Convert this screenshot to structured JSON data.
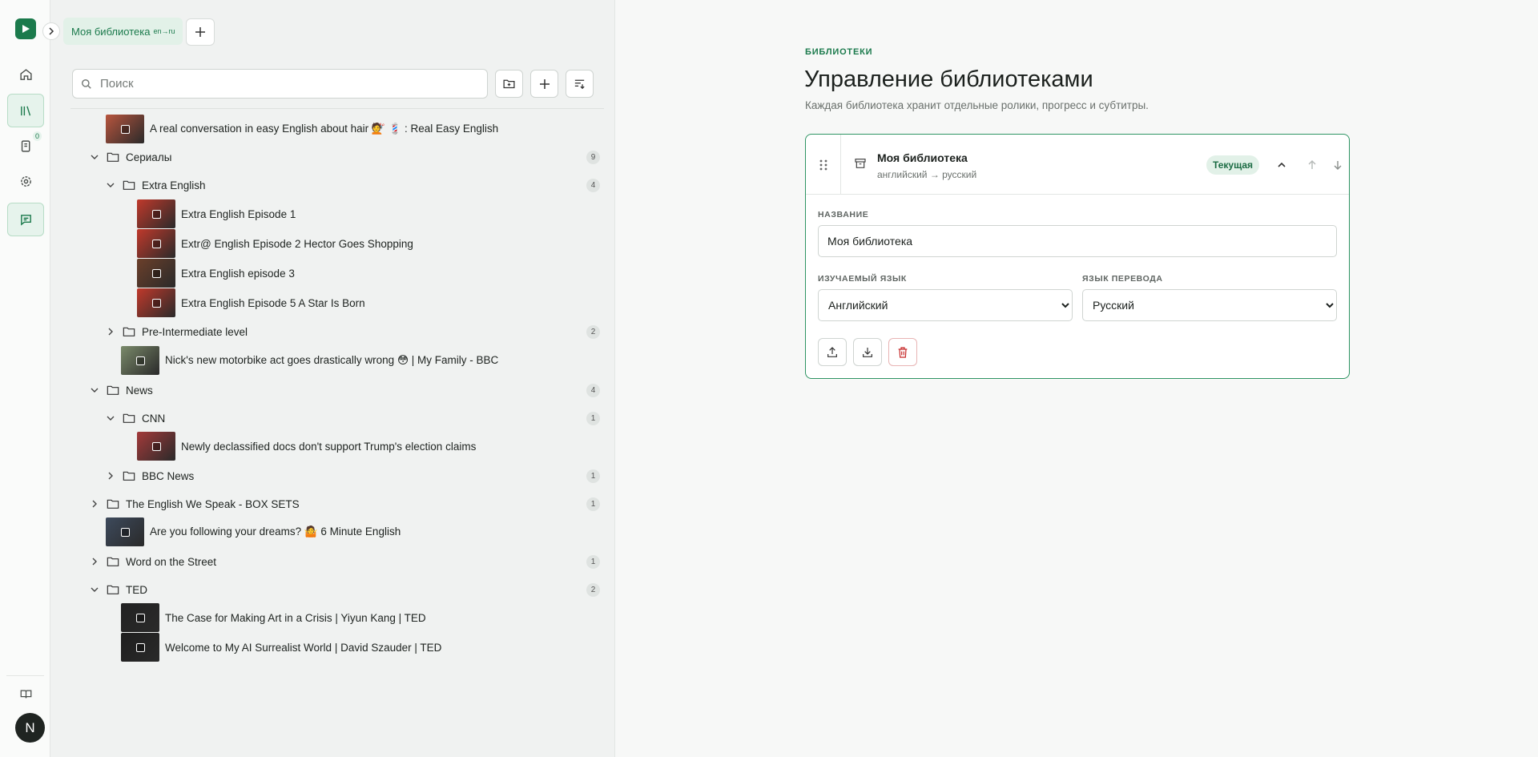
{
  "rail": {
    "notes_badge": "0",
    "avatar_letter": "N"
  },
  "sidebar": {
    "library_tab": {
      "name": "Моя библиотека",
      "langs": "en→ru"
    },
    "search": {
      "placeholder": "Поиск",
      "value": ""
    },
    "tree": [
      {
        "type": "video",
        "title": "A real conversation in easy English about hair 💇 💈 : Real Easy English",
        "thumb": "#b8553e"
      },
      {
        "type": "folder",
        "title": "Сериалы",
        "open": true,
        "count": "9"
      },
      {
        "type": "folder",
        "title": "Extra English",
        "open": true,
        "count": "4"
      },
      {
        "type": "video",
        "title": "Extra English Episode 1",
        "thumb": "#c0392b"
      },
      {
        "type": "video",
        "title": "Extr@ English Episode 2 Hector Goes Shopping",
        "thumb": "#c0392b"
      },
      {
        "type": "video",
        "title": "Extra English episode 3",
        "thumb": "#6b3f2a"
      },
      {
        "type": "video",
        "title": "Extra English Episode 5 A Star Is Born",
        "thumb": "#c0392b"
      },
      {
        "type": "folder",
        "title": "Pre-Intermediate level",
        "open": false,
        "count": "2"
      },
      {
        "type": "video",
        "title": "Nick's new motorbike act goes drastically wrong 😳 | My Family - BBC",
        "thumb": "#7a8a6a"
      },
      {
        "type": "folder",
        "title": "News",
        "open": true,
        "count": "4"
      },
      {
        "type": "folder",
        "title": "CNN",
        "open": true,
        "count": "1"
      },
      {
        "type": "video",
        "title": "Newly declassified docs don't support Trump's election claims",
        "thumb": "#a33a3a"
      },
      {
        "type": "folder",
        "title": "BBC News",
        "open": false,
        "count": "1"
      },
      {
        "type": "folder",
        "title": "The English We Speak - BOX SETS",
        "open": false,
        "count": "1"
      },
      {
        "type": "video",
        "title": "Are you following your dreams? 🤷 6 Minute English",
        "thumb": "#3d4a5c"
      },
      {
        "type": "folder",
        "title": "Word on the Street",
        "open": false,
        "count": "1"
      },
      {
        "type": "folder",
        "title": "TED",
        "open": true,
        "count": "2"
      },
      {
        "type": "video",
        "title": "The Case for Making Art in a Crisis | Yiyun Kang | TED",
        "thumb": "#222222"
      },
      {
        "type": "video",
        "title": "Welcome to My AI Surrealist World | David Szauder | TED",
        "thumb": "#1e1e1e"
      }
    ]
  },
  "main": {
    "eyebrow": "БИБЛИОТЕКИ",
    "title": "Управление библиотеками",
    "subtitle": "Каждая библиотека хранит отдельные ролики, прогресс и субтитры.",
    "card": {
      "name": "Моя библиотека",
      "pair": "английский → русский",
      "badge": "Текущая",
      "name_label": "НАЗВАНИЕ",
      "name_value": "Моя библиотека",
      "study_label": "ИЗУЧАЕМЫЙ ЯЗЫК",
      "study_value": "Английский",
      "translate_label": "ЯЗЫК ПЕРЕВОДА",
      "translate_value": "Русский"
    }
  },
  "colors": {
    "accent": "#1b7a4c",
    "danger": "#c62828"
  }
}
